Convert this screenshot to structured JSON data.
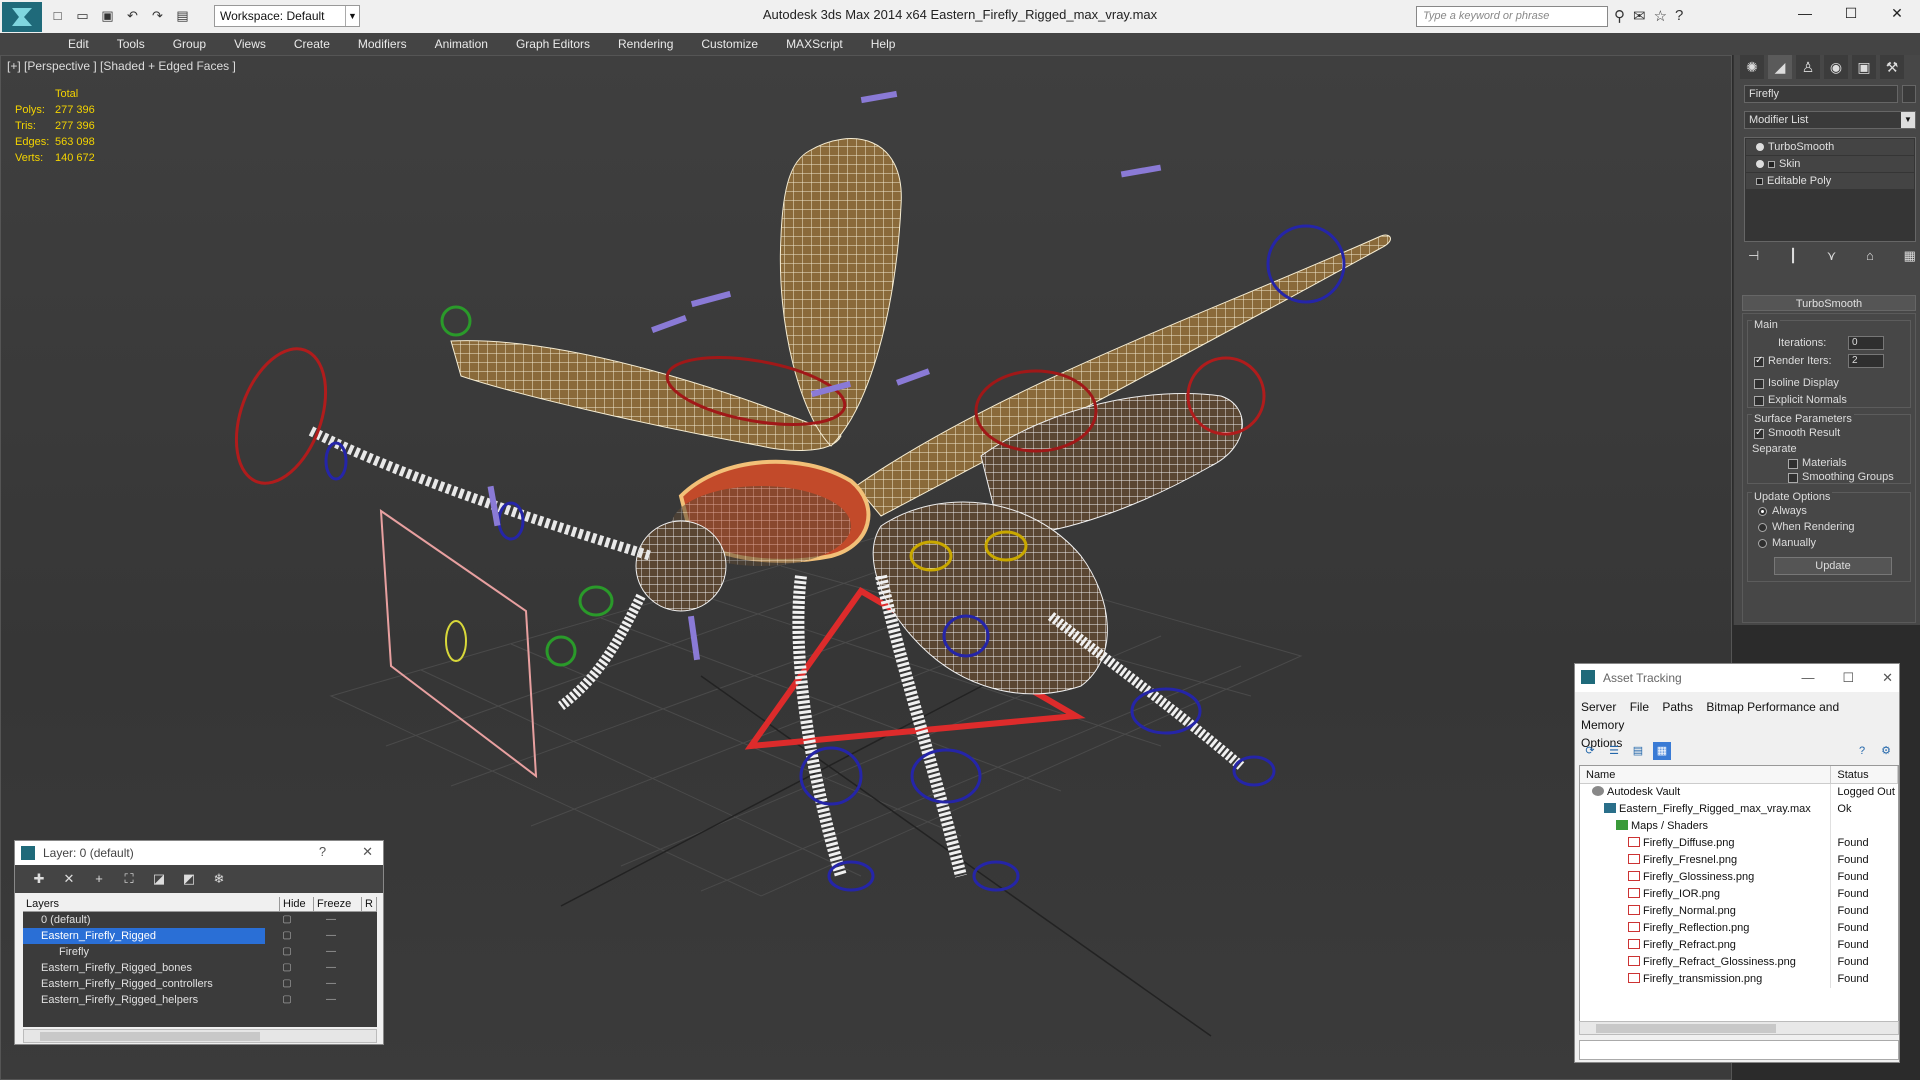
{
  "titlebar": {
    "workspace": "Workspace: Default",
    "title": "Autodesk 3ds Max  2014 x64       Eastern_Firefly_Rigged_max_vray.max",
    "search_placeholder": "Type a keyword or phrase",
    "quick_icons": [
      "new-file-icon",
      "open-file-icon",
      "save-icon",
      "undo-icon",
      "redo-icon",
      "project-folder-icon"
    ]
  },
  "menu": [
    "Edit",
    "Tools",
    "Group",
    "Views",
    "Create",
    "Modifiers",
    "Animation",
    "Graph Editors",
    "Rendering",
    "Customize",
    "MAXScript",
    "Help"
  ],
  "viewport": {
    "label": "[+] [Perspective ] [Shaded + Edged Faces ]",
    "stats": {
      "header": "Total",
      "rows": [
        {
          "k": "Polys:",
          "v": "277 396"
        },
        {
          "k": "Tris:",
          "v": "277 396"
        },
        {
          "k": "Edges:",
          "v": "563 098"
        },
        {
          "k": "Verts:",
          "v": "140 672"
        }
      ]
    }
  },
  "command_panel": {
    "object_name": "Firefly",
    "modifier_list": "Modifier List",
    "stack": [
      "TurboSmooth",
      "Skin",
      "Editable Poly"
    ],
    "rollout_title": "TurboSmooth",
    "main_group": "Main",
    "iterations_label": "Iterations:",
    "iterations": "0",
    "render_iters_label": "Render Iters:",
    "render_iters": "2",
    "isoline": "Isoline Display",
    "explicit_normals": "Explicit Normals",
    "surface_params": "Surface Parameters",
    "smooth_result": "Smooth Result",
    "separate": "Separate",
    "materials": "Materials",
    "smoothing_groups": "Smoothing Groups",
    "update_options": "Update Options",
    "always": "Always",
    "when_rendering": "When Rendering",
    "manually": "Manually",
    "update_btn": "Update"
  },
  "asset_tracking": {
    "title": "Asset Tracking",
    "menu": [
      "Server",
      "File",
      "Paths",
      "Bitmap Performance and Memory",
      "Options"
    ],
    "columns": [
      "Name",
      "Status"
    ],
    "rows": [
      {
        "name": "Autodesk Vault",
        "status": "Logged Out",
        "indent": 1,
        "icon": "vault"
      },
      {
        "name": "Eastern_Firefly_Rigged_max_vray.max",
        "status": "Ok",
        "indent": 2,
        "icon": "max"
      },
      {
        "name": "Maps / Shaders",
        "status": "",
        "indent": 3,
        "icon": "maps"
      },
      {
        "name": "Firefly_Diffuse.png",
        "status": "Found",
        "indent": 4,
        "icon": "png"
      },
      {
        "name": "Firefly_Fresnel.png",
        "status": "Found",
        "indent": 4,
        "icon": "png"
      },
      {
        "name": "Firefly_Glossiness.png",
        "status": "Found",
        "indent": 4,
        "icon": "png"
      },
      {
        "name": "Firefly_IOR.png",
        "status": "Found",
        "indent": 4,
        "icon": "png"
      },
      {
        "name": "Firefly_Normal.png",
        "status": "Found",
        "indent": 4,
        "icon": "png"
      },
      {
        "name": "Firefly_Reflection.png",
        "status": "Found",
        "indent": 4,
        "icon": "png"
      },
      {
        "name": "Firefly_Refract.png",
        "status": "Found",
        "indent": 4,
        "icon": "png"
      },
      {
        "name": "Firefly_Refract_Glossiness.png",
        "status": "Found",
        "indent": 4,
        "icon": "png"
      },
      {
        "name": "Firefly_transmission.png",
        "status": "Found",
        "indent": 4,
        "icon": "png"
      }
    ]
  },
  "layer_manager": {
    "title": "Layer: 0 (default)",
    "columns": [
      "Layers",
      "Hide",
      "Freeze",
      "R"
    ],
    "rows": [
      {
        "name": "0 (default)",
        "selected": false,
        "indent": 1
      },
      {
        "name": "Eastern_Firefly_Rigged",
        "selected": true,
        "indent": 1
      },
      {
        "name": "Firefly",
        "selected": false,
        "indent": 2
      },
      {
        "name": "Eastern_Firefly_Rigged_bones",
        "selected": false,
        "indent": 1
      },
      {
        "name": "Eastern_Firefly_Rigged_controllers",
        "selected": false,
        "indent": 1
      },
      {
        "name": "Eastern_Firefly_Rigged_helpers",
        "selected": false,
        "indent": 1
      }
    ]
  }
}
